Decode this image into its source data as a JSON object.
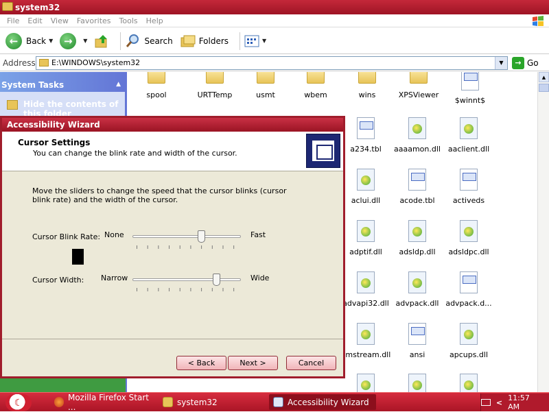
{
  "window": {
    "title": "system32"
  },
  "menu": [
    "File",
    "Edit",
    "View",
    "Favorites",
    "Tools",
    "Help"
  ],
  "toolbar": {
    "back": "Back",
    "search": "Search",
    "folders": "Folders"
  },
  "address": {
    "label": "Address",
    "value": "E:\\WINDOWS\\system32",
    "go": "Go"
  },
  "tasks": {
    "header": "System Tasks",
    "item": "Hide the contents of this folder"
  },
  "files": [
    {
      "name": "spool",
      "icon": "folder-icon"
    },
    {
      "name": "URTTemp",
      "icon": "folder-icon"
    },
    {
      "name": "usmt",
      "icon": "folder-icon"
    },
    {
      "name": "wbem",
      "icon": "folder-icon"
    },
    {
      "name": "wins",
      "icon": "folder-icon"
    },
    {
      "name": "XPSViewer",
      "icon": "folder-icon"
    },
    {
      "name": "$winnt$",
      "icon": "settings-file-icon"
    },
    {
      "name": "a234.tbl",
      "icon": "document-icon"
    },
    {
      "name": "aaaamon.dll",
      "icon": "dll-icon"
    },
    {
      "name": "aaclient.dll",
      "icon": "dll-icon"
    },
    {
      "name": "aclui.dll",
      "icon": "dll-icon"
    },
    {
      "name": "acode.tbl",
      "icon": "document-icon"
    },
    {
      "name": "activeds",
      "icon": "document-icon"
    },
    {
      "name": "adptif.dll",
      "icon": "dll-icon"
    },
    {
      "name": "adsldp.dll",
      "icon": "dll-icon"
    },
    {
      "name": "adsldpc.dll",
      "icon": "dll-icon"
    },
    {
      "name": "advapi32.dll",
      "icon": "dll-icon"
    },
    {
      "name": "advpack.dll",
      "icon": "dll-icon"
    },
    {
      "name": "advpack.d...",
      "icon": "document-icon"
    },
    {
      "name": "amstream.dll",
      "icon": "dll-icon"
    },
    {
      "name": "ansi",
      "icon": "document-icon"
    },
    {
      "name": "apcups.dll",
      "icon": "dll-icon"
    }
  ],
  "wizard": {
    "title": "Accessibility Wizard",
    "heading": "Cursor Settings",
    "subheading": "You can change the blink rate and width of the cursor.",
    "description": "Move the sliders to change the speed that the cursor blinks (cursor blink rate) and the width of the cursor.",
    "blink": {
      "label": "Cursor Blink Rate:",
      "min": "None",
      "max": "Fast",
      "value": 0.63
    },
    "width": {
      "label": "Cursor Width:",
      "min": "Narrow",
      "max": "Wide",
      "value": 0.77
    },
    "buttons": {
      "back": "< Back",
      "next": "Next >",
      "cancel": "Cancel"
    }
  },
  "taskbar": {
    "tasks": [
      "Mozilla Firefox Start ...",
      "system32",
      "Accessibility Wizard"
    ],
    "clock": "11:57 AM",
    "tray_arrow": "<"
  }
}
